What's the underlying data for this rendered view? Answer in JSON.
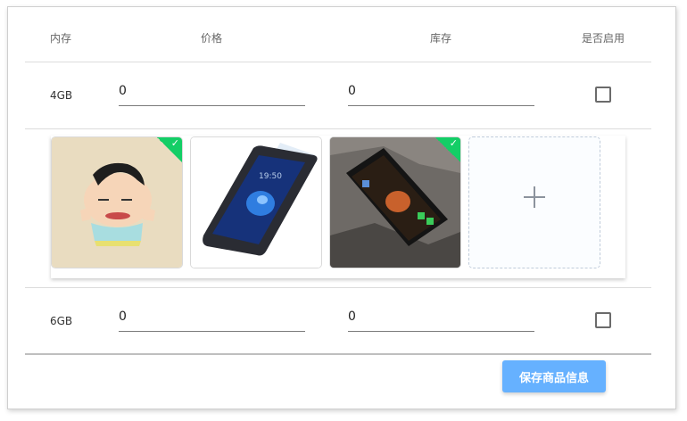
{
  "table": {
    "headers": {
      "memory": "内存",
      "price": "价格",
      "stock": "库存",
      "enabled": "是否启用"
    },
    "rows": [
      {
        "memory": "4GB",
        "price": "0",
        "stock": "0",
        "enabled": false
      },
      {
        "memory": "6GB",
        "price": "0",
        "stock": "0",
        "enabled": false
      }
    ]
  },
  "images": [
    {
      "icon": "cartoon-boy-image",
      "uploaded": true
    },
    {
      "icon": "phone-screen-protector-image",
      "uploaded": false
    },
    {
      "icon": "phone-on-rocks-image",
      "uploaded": true
    }
  ],
  "upload": {
    "icon": "plus-icon"
  },
  "actions": {
    "save_label": "保存商品信息"
  },
  "colors": {
    "success": "#13ce66",
    "primary_light": "#66b1ff"
  }
}
